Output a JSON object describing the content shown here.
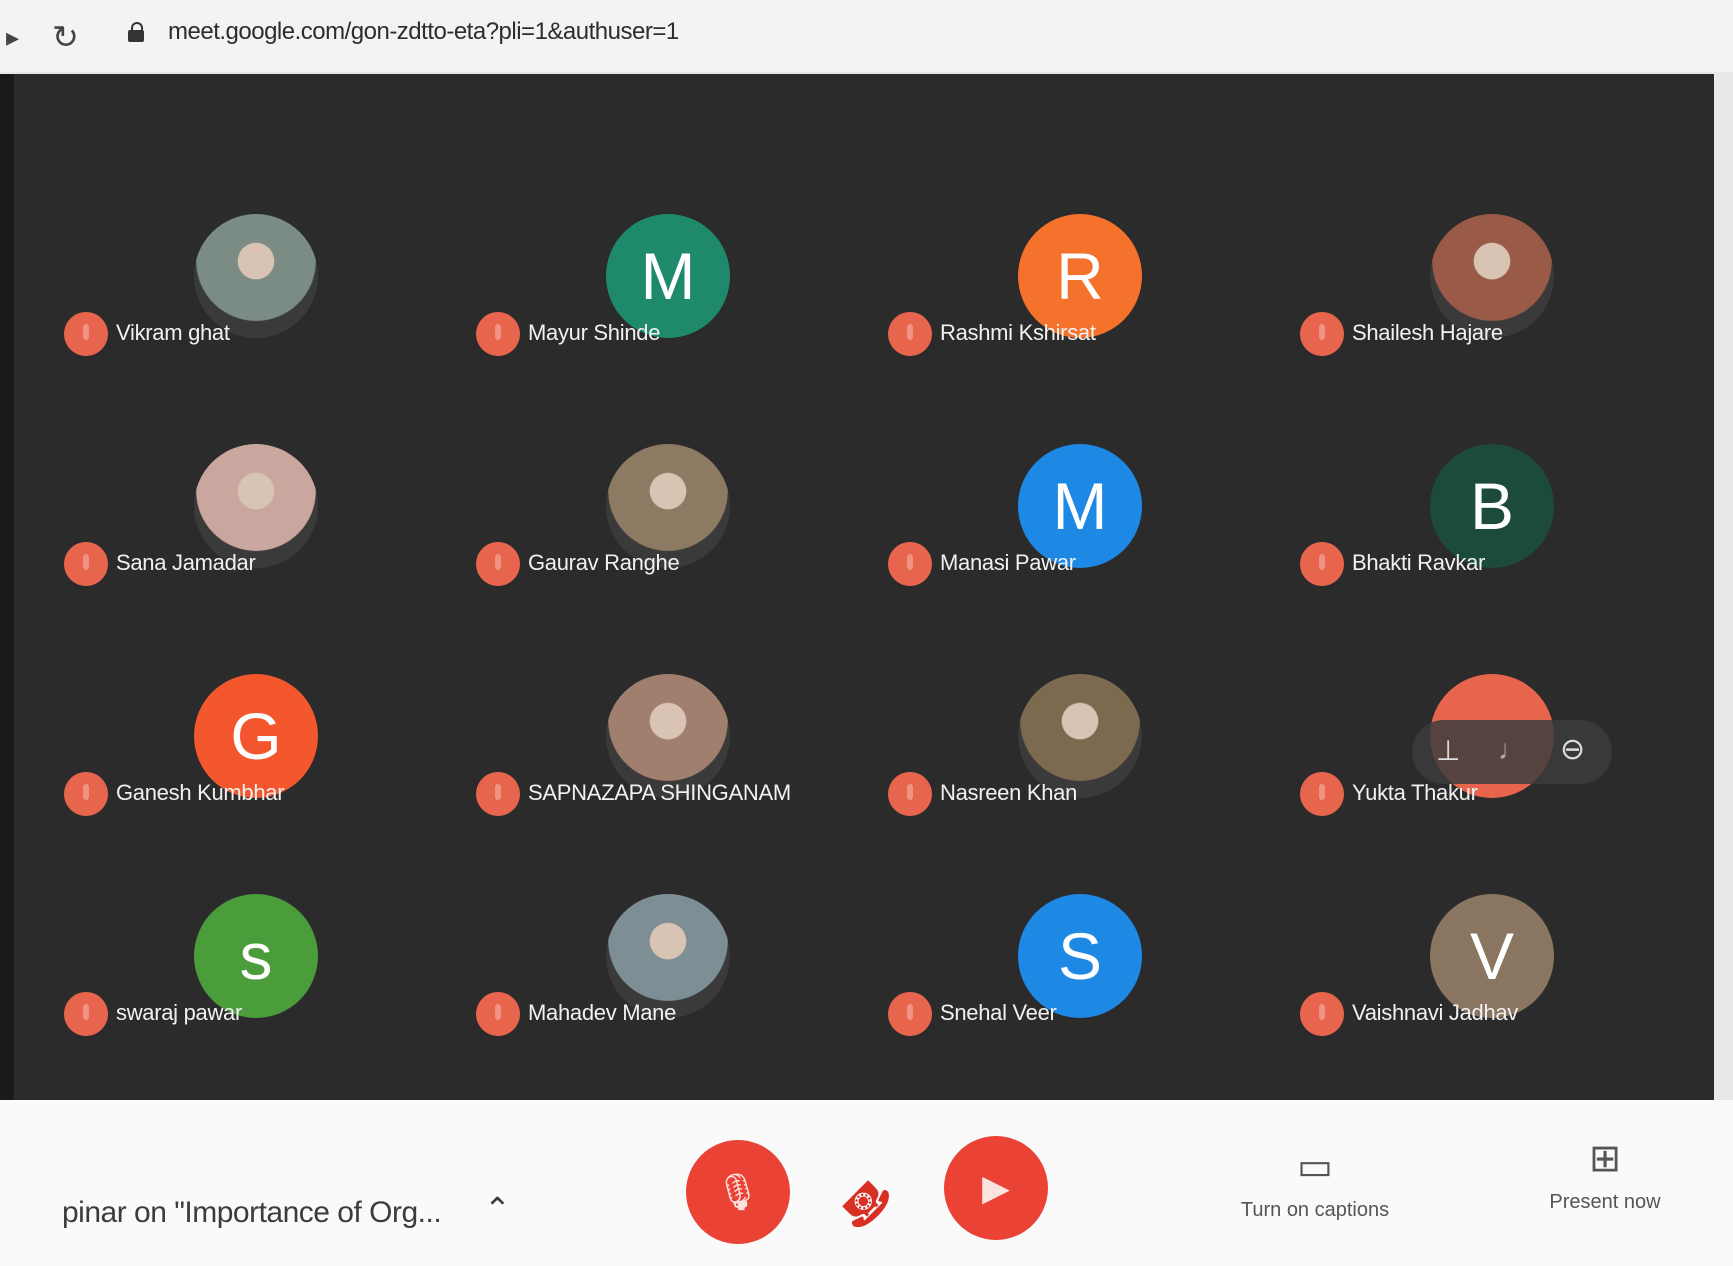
{
  "browser": {
    "url": "meet.google.com/gon-zdtto-eta?pli=1&authuser=1"
  },
  "participants": [
    {
      "name": "Vikram ghat",
      "initial": "",
      "photo": true,
      "color": "#7a8c84"
    },
    {
      "name": "Mayur Shinde",
      "initial": "M",
      "photo": false,
      "color": "#1f8a6b"
    },
    {
      "name": "Rashmi Kshirsat",
      "initial": "R",
      "photo": false,
      "color": "#f4722c"
    },
    {
      "name": "Shailesh Hajare",
      "initial": "",
      "photo": true,
      "color": "#9a5a48"
    },
    {
      "name": "Sana Jamadar",
      "initial": "",
      "photo": true,
      "color": "#c9a79f"
    },
    {
      "name": "Gaurav Ranghe",
      "initial": "",
      "photo": true,
      "color": "#8c7b62"
    },
    {
      "name": "Manasi Pawar",
      "initial": "M",
      "photo": false,
      "color": "#1e88e5"
    },
    {
      "name": "Bhakti Ravkar",
      "initial": "B",
      "photo": false,
      "color": "#1c4a3d"
    },
    {
      "name": "Ganesh Kumbhar",
      "initial": "G",
      "photo": false,
      "color": "#f4572d"
    },
    {
      "name": "SAPNAZAPA SHINGANAM",
      "initial": "",
      "photo": true,
      "color": "#a17f6e"
    },
    {
      "name": "Nasreen Khan",
      "initial": "",
      "photo": true,
      "color": "#7c6a50"
    },
    {
      "name": "Yukta Thakur",
      "initial": "",
      "photo": false,
      "color": "#e8654d"
    },
    {
      "name": "swaraj pawar",
      "initial": "s",
      "photo": false,
      "color": "#4a9d3a"
    },
    {
      "name": "Mahadev Mane",
      "initial": "",
      "photo": true,
      "color": "#7d8e95"
    },
    {
      "name": "Snehal Veer",
      "initial": "S",
      "photo": false,
      "color": "#1e88e5"
    },
    {
      "name": "Vaishnavi Jadhav",
      "initial": "V",
      "photo": false,
      "color": "#8a7560"
    }
  ],
  "controls": {
    "meeting_title": "pinar on \"Importance of Org...",
    "captions_label": "Turn on captions",
    "present_label": "Present now",
    "accent": "#ea4335"
  }
}
